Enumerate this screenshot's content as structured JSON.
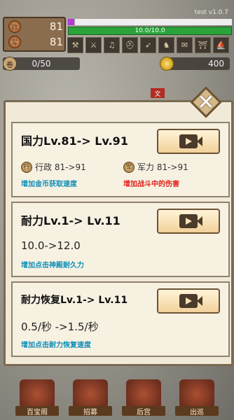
{
  "version": "test v1.0.7",
  "hud": {
    "stat_top": "81",
    "stat_bottom": "81",
    "hp_text": "10.0/10.0",
    "scroll_count": "0/50",
    "coins": "400",
    "red_seal": "文",
    "equipment_icons": [
      "axe-icon",
      "weapon-icon",
      "lute-icon",
      "helmet-icon",
      "bow-icon",
      "horse-icon",
      "scroll-icon",
      "gate-icon",
      "ship-icon"
    ]
  },
  "modal": {
    "close_label": "✕",
    "cards": [
      {
        "title": "国力Lv.81-> Lv.91",
        "attr_a_icon": "行",
        "attr_a": "行政 81->91",
        "attr_a_desc": "增加金币获取速度",
        "attr_b_icon": "军",
        "attr_b": "军力 81->91",
        "attr_b_desc": "增加战斗中的伤害"
      },
      {
        "title": "耐力Lv.1-> Lv.11",
        "value": "10.0->12.0",
        "desc": "增加点击神殿耐久力"
      },
      {
        "title": "耐力恢复Lv.1-> Lv.11",
        "value": "0.5/秒 ->1.5/秒",
        "desc": "增加点击耐力恢复速度"
      }
    ]
  },
  "bottom_nav": [
    {
      "label": "百宝阁"
    },
    {
      "label": "招募"
    },
    {
      "label": "后宫"
    },
    {
      "label": "出巡"
    }
  ],
  "colors": {
    "accent_blue": "#0d8fb8",
    "accent_red": "#e3201a",
    "hp_green": "#2aa33a"
  }
}
